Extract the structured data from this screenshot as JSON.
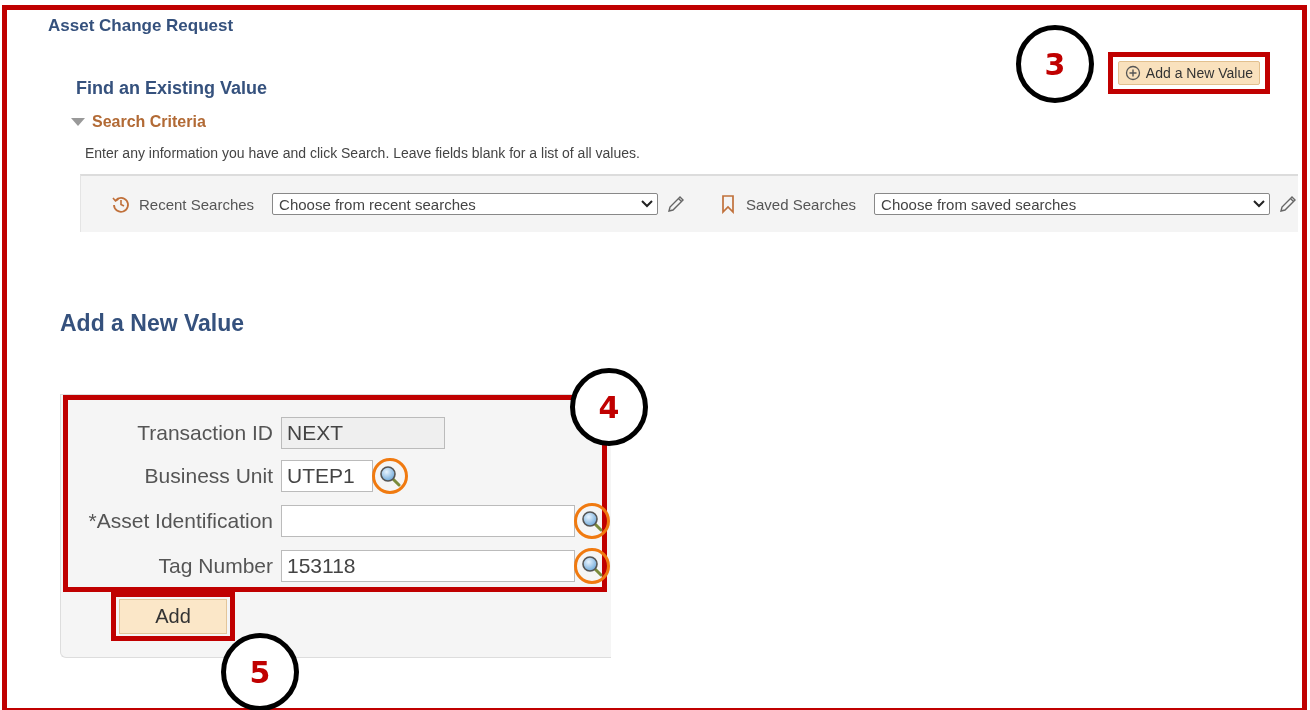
{
  "page_title": "Asset Change Request",
  "add_new_value_link": {
    "label": "Add a New Value",
    "highlighted": true,
    "callout": "3"
  },
  "find_section": {
    "title": "Find an Existing Value",
    "search_criteria": {
      "label": "Search Criteria",
      "expanded": true
    },
    "instructions": "Enter any information you have and click Search. Leave fields blank for a list of all values.",
    "recent_searches": {
      "label": "Recent Searches",
      "value": "Choose from recent searches"
    },
    "saved_searches": {
      "label": "Saved Searches",
      "value": "Choose from saved searches"
    }
  },
  "add_section": {
    "title": "Add a New Value",
    "highlighted": true,
    "callout": "4",
    "fields": [
      {
        "label": "Transaction ID",
        "value": "NEXT",
        "disabled": true,
        "lookup": false
      },
      {
        "label": "Business Unit",
        "value": "UTEP1",
        "disabled": false,
        "lookup": true,
        "lookup_circled": true
      },
      {
        "label": "*Asset Identification",
        "disabled": false,
        "lookup": true,
        "lookup_circled": true
      },
      {
        "label": "Tag Number",
        "value": "153118",
        "disabled": false,
        "lookup": true,
        "lookup_circled": true
      }
    ],
    "add_button": {
      "label": "Add",
      "highlighted": true,
      "callout": "5"
    }
  }
}
